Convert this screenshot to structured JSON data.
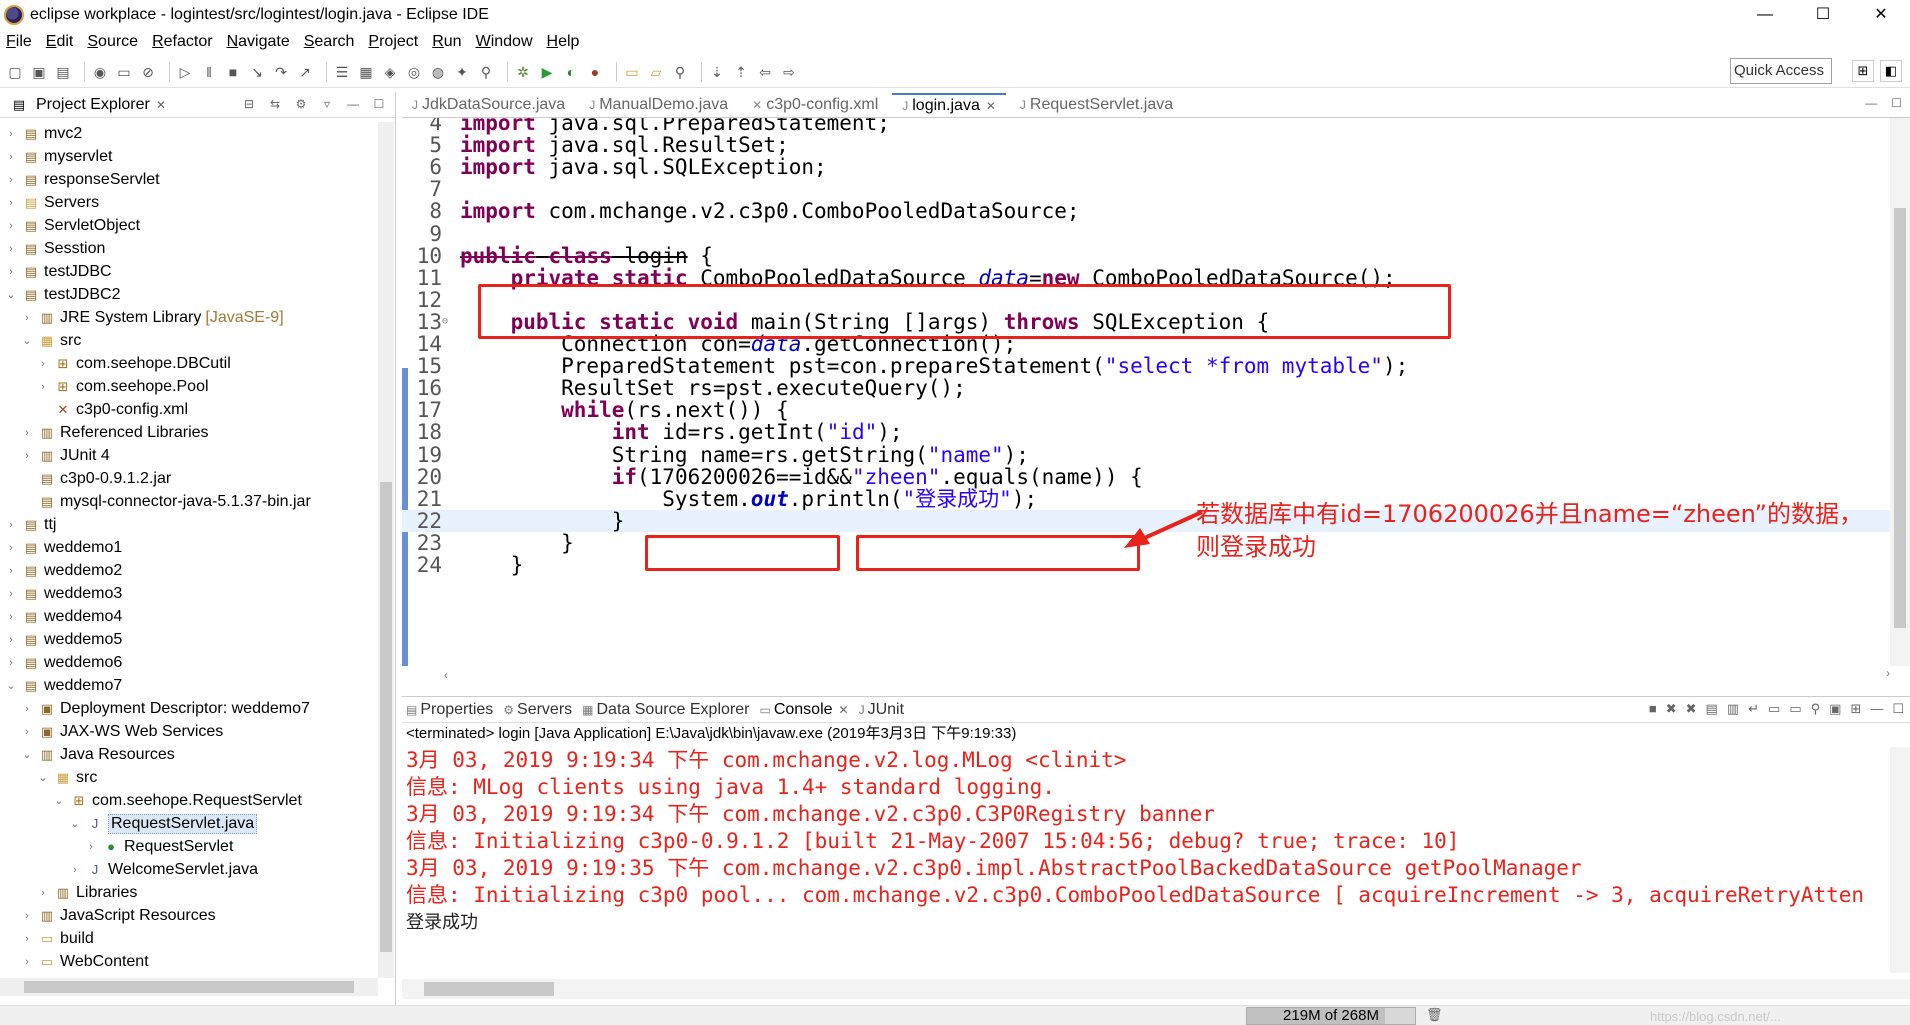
{
  "window": {
    "title": "eclipse workplace - logintest/src/logintest/login.java - Eclipse IDE",
    "minimize": "—",
    "maximize": "☐",
    "close": "✕"
  },
  "menu": [
    {
      "label": "File"
    },
    {
      "label": "Edit"
    },
    {
      "label": "Source"
    },
    {
      "label": "Refactor"
    },
    {
      "label": "Navigate"
    },
    {
      "label": "Search"
    },
    {
      "label": "Project"
    },
    {
      "label": "Run"
    },
    {
      "label": "Window"
    },
    {
      "label": "Help"
    }
  ],
  "toolbar": {
    "quick_access": "Quick Access"
  },
  "project_explorer": {
    "title": "Project Explorer",
    "items": [
      {
        "label": "mvc2",
        "indent": 0,
        "twisty": "›",
        "icon": "project-icon",
        "glyph": "▤"
      },
      {
        "label": "myservlet",
        "indent": 0,
        "twisty": "›",
        "icon": "project-icon",
        "glyph": "▤"
      },
      {
        "label": "responseServlet",
        "indent": 0,
        "twisty": "›",
        "icon": "project-icon",
        "glyph": "▤"
      },
      {
        "label": "Servers",
        "indent": 0,
        "twisty": "›",
        "icon": "folder-icon",
        "glyph": "▤"
      },
      {
        "label": "ServletObject",
        "indent": 0,
        "twisty": "›",
        "icon": "project-icon",
        "glyph": "▤"
      },
      {
        "label": "Sesstion",
        "indent": 0,
        "twisty": "›",
        "icon": "project-icon",
        "glyph": "▤"
      },
      {
        "label": "testJDBC",
        "indent": 0,
        "twisty": "›",
        "icon": "project-icon",
        "glyph": "▤"
      },
      {
        "label": "testJDBC2",
        "indent": 0,
        "twisty": "⌄",
        "icon": "project-icon",
        "glyph": "▤"
      },
      {
        "label": "JRE System Library",
        "tag": "[JavaSE-9]",
        "indent": 1,
        "twisty": "›",
        "icon": "library-icon",
        "glyph": "▥"
      },
      {
        "label": "src",
        "indent": 1,
        "twisty": "⌄",
        "icon": "source-folder-icon",
        "glyph": "▦"
      },
      {
        "label": "com.seehope.DBCutil",
        "indent": 2,
        "twisty": "›",
        "icon": "package-icon",
        "glyph": "⊞"
      },
      {
        "label": "com.seehope.Pool",
        "indent": 2,
        "twisty": "›",
        "icon": "package-icon",
        "glyph": "⊞"
      },
      {
        "label": "c3p0-config.xml",
        "indent": 2,
        "twisty": "",
        "icon": "xml-file-icon",
        "glyph": "✕"
      },
      {
        "label": "Referenced Libraries",
        "indent": 1,
        "twisty": "›",
        "icon": "library-icon",
        "glyph": "▥"
      },
      {
        "label": "JUnit 4",
        "indent": 1,
        "twisty": "›",
        "icon": "library-icon",
        "glyph": "▥"
      },
      {
        "label": "c3p0-0.9.1.2.jar",
        "indent": 1,
        "twisty": "",
        "icon": "jar-icon",
        "glyph": "▤"
      },
      {
        "label": "mysql-connector-java-5.1.37-bin.jar",
        "indent": 1,
        "twisty": "",
        "icon": "jar-icon",
        "glyph": "▤"
      },
      {
        "label": "ttj",
        "indent": 0,
        "twisty": "›",
        "icon": "project-icon",
        "glyph": "▤"
      },
      {
        "label": "weddemo1",
        "indent": 0,
        "twisty": "›",
        "icon": "project-icon",
        "glyph": "▤"
      },
      {
        "label": "weddemo2",
        "indent": 0,
        "twisty": "›",
        "icon": "project-icon",
        "glyph": "▤"
      },
      {
        "label": "weddemo3",
        "indent": 0,
        "twisty": "›",
        "icon": "project-icon",
        "glyph": "▤"
      },
      {
        "label": "weddemo4",
        "indent": 0,
        "twisty": "›",
        "icon": "project-icon",
        "glyph": "▤"
      },
      {
        "label": "weddemo5",
        "indent": 0,
        "twisty": "›",
        "icon": "project-icon",
        "glyph": "▤"
      },
      {
        "label": "weddemo6",
        "indent": 0,
        "twisty": "›",
        "icon": "project-icon",
        "glyph": "▤"
      },
      {
        "label": "weddemo7",
        "indent": 0,
        "twisty": "⌄",
        "icon": "project-icon",
        "glyph": "▤"
      },
      {
        "label": "Deployment Descriptor: weddemo7",
        "indent": 1,
        "twisty": "›",
        "icon": "descriptor-icon",
        "glyph": "▣"
      },
      {
        "label": "JAX-WS Web Services",
        "indent": 1,
        "twisty": "›",
        "icon": "webservice-icon",
        "glyph": "▣"
      },
      {
        "label": "Java Resources",
        "indent": 1,
        "twisty": "⌄",
        "icon": "resources-icon",
        "glyph": "▥"
      },
      {
        "label": "src",
        "indent": 2,
        "twisty": "⌄",
        "icon": "source-folder-icon",
        "glyph": "▦"
      },
      {
        "label": "com.seehope.RequestServlet",
        "indent": 3,
        "twisty": "⌄",
        "icon": "package-icon",
        "glyph": "⊞"
      },
      {
        "label": "RequestServlet.java",
        "indent": 4,
        "twisty": "⌄",
        "icon": "java-file-icon",
        "glyph": "J",
        "selected": true
      },
      {
        "label": "RequestServlet",
        "indent": 5,
        "twisty": "›",
        "icon": "class-icon",
        "glyph": "●"
      },
      {
        "label": "WelcomeServlet.java",
        "indent": 4,
        "twisty": "›",
        "icon": "java-file-icon",
        "glyph": "J"
      },
      {
        "label": "Libraries",
        "indent": 2,
        "twisty": "›",
        "icon": "library-icon",
        "glyph": "▥"
      },
      {
        "label": "JavaScript Resources",
        "indent": 1,
        "twisty": "›",
        "icon": "resources-icon",
        "glyph": "▥"
      },
      {
        "label": "build",
        "indent": 1,
        "twisty": "›",
        "icon": "folder-icon",
        "glyph": "▭"
      },
      {
        "label": "WebContent",
        "indent": 1,
        "twisty": "›",
        "icon": "folder-icon",
        "glyph": "▭"
      }
    ]
  },
  "editor": {
    "tabs": [
      {
        "label": "JdkDataSource.java",
        "active": false
      },
      {
        "label": "ManualDemo.java",
        "active": false
      },
      {
        "label": "c3p0-config.xml",
        "active": false
      },
      {
        "label": "login.java",
        "active": true
      },
      {
        "label": "RequestServlet.java",
        "active": false
      }
    ],
    "lines": [
      {
        "n": "4",
        "html": "<span class=\"kw\">import</span> java.sql.PreparedStatement;"
      },
      {
        "n": "5",
        "html": "<span class=\"kw\">import</span> java.sql.ResultSet;"
      },
      {
        "n": "6",
        "html": "<span class=\"kw\">import</span> java.sql.SQLException;"
      },
      {
        "n": "7",
        "html": ""
      },
      {
        "n": "8",
        "html": "<span class=\"kw\">import</span> com.mchange.v2.c3p0.ComboPooledDataSource;"
      },
      {
        "n": "9",
        "html": ""
      },
      {
        "n": "10",
        "html": "<span class=\"kw strike\">public</span><span class=\"strike\"> </span><span class=\"kw strike\">class</span><span class=\"strike\"> login</span> {"
      },
      {
        "n": "11",
        "html": "    <span class=\"kw\">private</span> <span class=\"kw\">static</span> ComboPooledDataSource <span class=\"fld\">data</span>=<span class=\"kw\">new</span> ComboPooledDataSource();"
      },
      {
        "n": "12",
        "html": ""
      },
      {
        "n": "13",
        "html": "    <span class=\"kw\">public</span> <span class=\"kw\">static</span> <span class=\"kw\">void</span> main(String []args) <span class=\"kw\">throws</span> SQLException {",
        "fold": "⊖"
      },
      {
        "n": "14",
        "html": "        Connection con=<span class=\"fld\">data</span>.getConnection();"
      },
      {
        "n": "15",
        "html": "        PreparedStatement pst=con.prepareStatement(<span class=\"str\">\"select *from mytable\"</span>);"
      },
      {
        "n": "16",
        "html": "        ResultSet rs=pst.executeQuery();"
      },
      {
        "n": "17",
        "html": "        <span class=\"kw\">while</span>(rs.next()) {"
      },
      {
        "n": "18",
        "html": "            <span class=\"kw\">int</span> id=rs.getInt(<span class=\"str\">\"id\"</span>);"
      },
      {
        "n": "19",
        "html": "            String name=rs.getString(<span class=\"str\">\"name\"</span>);"
      },
      {
        "n": "20",
        "html": "            <span class=\"kw\">if</span>(1706200026==id&amp;&amp;<span class=\"str\">\"zheen\"</span>.equals(name)) {"
      },
      {
        "n": "21",
        "html": "                System.<span class=\"fld\" style=\"font-weight:bold\">out</span>.println(<span class=\"str\">\"登录成功\"</span>);"
      },
      {
        "n": "22",
        "html": "            }",
        "current": true
      },
      {
        "n": "23",
        "html": "        }"
      },
      {
        "n": "24",
        "html": "    }"
      }
    ]
  },
  "annotation": {
    "line1": "若数据库中有id=1706200026并且name=“zheen”的数据，",
    "line2": "则登录成功"
  },
  "console": {
    "tabs": [
      {
        "label": "Properties",
        "icon": "properties-icon"
      },
      {
        "label": "Servers",
        "icon": "servers-icon"
      },
      {
        "label": "Data Source Explorer",
        "icon": "datasource-icon"
      },
      {
        "label": "Console",
        "icon": "console-icon",
        "active": true
      },
      {
        "label": "JUnit",
        "icon": "junit-icon"
      }
    ],
    "terminated": "<terminated> login [Java Application] E:\\Java\\jdk\\bin\\javaw.exe (2019年3月3日 下午9:19:33)",
    "lines": [
      {
        "text": "3月 03, 2019 9:19:34 下午 com.mchange.v2.log.MLog <clinit>",
        "err": true
      },
      {
        "text": "信息: MLog clients using java 1.4+ standard logging.",
        "err": true
      },
      {
        "text": "3月 03, 2019 9:19:34 下午 com.mchange.v2.c3p0.C3P0Registry banner",
        "err": true
      },
      {
        "text": "信息: Initializing c3p0-0.9.1.2 [built 21-May-2007 15:04:56; debug? true; trace: 10]",
        "err": true
      },
      {
        "text": "3月 03, 2019 9:19:35 下午 com.mchange.v2.c3p0.impl.AbstractPoolBackedDataSource getPoolManager",
        "err": true
      },
      {
        "text": "信息: Initializing c3p0 pool... com.mchange.v2.c3p0.ComboPooledDataSource [ acquireIncrement -> 3, acquireRetryAtten",
        "err": true
      },
      {
        "text": "登录成功",
        "err": false
      }
    ]
  },
  "status": {
    "heap": "219M of 268M",
    "heap_used_fraction": 0.82,
    "watermark": "https://blog.csdn.net/..."
  }
}
